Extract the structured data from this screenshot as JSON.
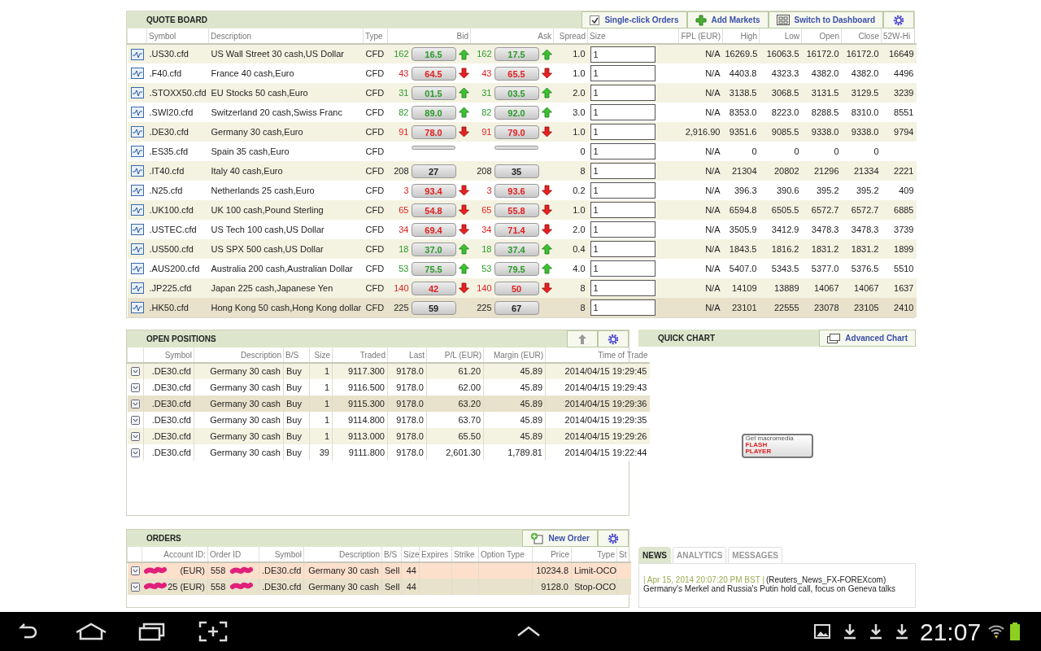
{
  "quote_board": {
    "title": "QUOTE BOARD",
    "toolbar": [
      {
        "kind": "checkbox",
        "label": "Single-click Orders",
        "checked": true
      },
      {
        "kind": "add",
        "label": "Add Markets"
      },
      {
        "kind": "dashboard",
        "label": "Switch to Dashboard"
      },
      {
        "kind": "settings"
      }
    ],
    "columns": [
      "Symbol",
      "Description",
      "Type",
      "Bid",
      "Ask",
      "Spread",
      "Size",
      "FPL (EUR)",
      "High",
      "Low",
      "Open",
      "Close",
      "52W-Hi"
    ],
    "rows": [
      {
        "symbol": ".US30.cfd",
        "description": "US Wall Street 30 cash,US Dollar",
        "type": "CFD",
        "bid": {
          "pips": "162",
          "price": "16.5",
          "kind": "up"
        },
        "ask": {
          "pips": "162",
          "price": "17.5",
          "kind": "up"
        },
        "spread": "1.0",
        "size": "1",
        "fpl": "N/A",
        "high": "16269.5",
        "low": "16063.5",
        "open": "16172.0",
        "close": "16172.0",
        "high_52w": "16649",
        "selected": false
      },
      {
        "symbol": ".F40.cfd",
        "description": "France 40 cash,Euro",
        "type": "CFD",
        "bid": {
          "pips": "43",
          "price": "64.5",
          "kind": "down"
        },
        "ask": {
          "pips": "43",
          "price": "65.5",
          "kind": "down"
        },
        "spread": "1.0",
        "size": "1",
        "fpl": "N/A",
        "high": "4403.8",
        "low": "4323.3",
        "open": "4382.0",
        "close": "4382.0",
        "high_52w": "4496",
        "selected": false
      },
      {
        "symbol": ".STOXX50.cfd",
        "description": "EU Stocks 50 cash,Euro",
        "type": "CFD",
        "bid": {
          "pips": "31",
          "price": "01.5",
          "kind": "up"
        },
        "ask": {
          "pips": "31",
          "price": "03.5",
          "kind": "up"
        },
        "spread": "2.0",
        "size": "1",
        "fpl": "N/A",
        "high": "3138.5",
        "low": "3068.5",
        "open": "3131.5",
        "close": "3129.5",
        "high_52w": "3239",
        "selected": false
      },
      {
        "symbol": ".SWI20.cfd",
        "description": "Switzerland 20 cash,Swiss Franc",
        "type": "CFD",
        "bid": {
          "pips": "82",
          "price": "89.0",
          "kind": "up"
        },
        "ask": {
          "pips": "82",
          "price": "92.0",
          "kind": "up"
        },
        "spread": "3.0",
        "size": "1",
        "fpl": "N/A",
        "high": "8353.0",
        "low": "8223.0",
        "open": "8288.5",
        "close": "8310.0",
        "high_52w": "8551",
        "selected": false
      },
      {
        "symbol": ".DE30.cfd",
        "description": "Germany 30 cash,Euro",
        "type": "CFD",
        "bid": {
          "pips": "91",
          "price": "78.0",
          "kind": "down"
        },
        "ask": {
          "pips": "91",
          "price": "79.0",
          "kind": "down"
        },
        "spread": "1.0",
        "size": "1",
        "fpl": "2,916.90",
        "high": "9351.6",
        "low": "9085.5",
        "open": "9338.0",
        "close": "9338.0",
        "high_52w": "9794",
        "selected": false
      },
      {
        "symbol": ".ES35.cfd",
        "description": "Spain 35 cash,Euro",
        "type": "CFD",
        "bid": {
          "kind": "none"
        },
        "ask": {
          "kind": "none"
        },
        "spread": "0",
        "size": "1",
        "fpl": "N/A",
        "high": "0",
        "low": "0",
        "open": "0",
        "close": "0",
        "selected": false
      },
      {
        "symbol": ".IT40.cfd",
        "description": "Italy 40 cash,Euro",
        "type": "CFD",
        "bid": {
          "pips": "208",
          "price": "27",
          "kind": "none"
        },
        "ask": {
          "pips": "208",
          "price": "35",
          "kind": "none"
        },
        "spread": "8",
        "size": "1",
        "fpl": "N/A",
        "high": "21304",
        "low": "20802",
        "open": "21296",
        "close": "21334",
        "high_52w": "2221",
        "selected": false
      },
      {
        "symbol": ".N25.cfd",
        "description": "Netherlands 25 cash,Euro",
        "type": "CFD",
        "bid": {
          "pips": "3",
          "price": "93.4",
          "kind": "down"
        },
        "ask": {
          "pips": "3",
          "price": "93.6",
          "kind": "down"
        },
        "spread": "0.2",
        "size": "1",
        "fpl": "N/A",
        "high": "396.3",
        "low": "390.6",
        "open": "395.2",
        "close": "395.2",
        "high_52w": "409",
        "selected": false
      },
      {
        "symbol": ".UK100.cfd",
        "description": "UK 100 cash,Pound Sterling",
        "type": "CFD",
        "bid": {
          "pips": "65",
          "price": "54.8",
          "kind": "down"
        },
        "ask": {
          "pips": "65",
          "price": "55.8",
          "kind": "down"
        },
        "spread": "1.0",
        "size": "1",
        "fpl": "N/A",
        "high": "6594.8",
        "low": "6505.5",
        "open": "6572.7",
        "close": "6572.7",
        "high_52w": "6885",
        "selected": false
      },
      {
        "symbol": ".USTEC.cfd",
        "description": "US Tech 100 cash,US Dollar",
        "type": "CFD",
        "bid": {
          "pips": "34",
          "price": "69.4",
          "kind": "down"
        },
        "ask": {
          "pips": "34",
          "price": "71.4",
          "kind": "down"
        },
        "spread": "2.0",
        "size": "1",
        "fpl": "N/A",
        "high": "3505.9",
        "low": "3412.9",
        "open": "3478.3",
        "close": "3478.3",
        "high_52w": "3739",
        "selected": false
      },
      {
        "symbol": ".US500.cfd",
        "description": "US SPX 500 cash,US Dollar",
        "type": "CFD",
        "bid": {
          "pips": "18",
          "price": "37.0",
          "kind": "up"
        },
        "ask": {
          "pips": "18",
          "price": "37.4",
          "kind": "up"
        },
        "spread": "0.4",
        "size": "1",
        "fpl": "N/A",
        "high": "1843.5",
        "low": "1816.2",
        "open": "1831.2",
        "close": "1831.2",
        "high_52w": "1899",
        "selected": false
      },
      {
        "symbol": ".AUS200.cfd",
        "description": "Australia 200 cash,Australian Dollar",
        "type": "CFD",
        "bid": {
          "pips": "53",
          "price": "75.5",
          "kind": "up"
        },
        "ask": {
          "pips": "53",
          "price": "79.5",
          "kind": "up"
        },
        "spread": "4.0",
        "size": "1",
        "fpl": "N/A",
        "high": "5407.0",
        "low": "5343.5",
        "open": "5377.0",
        "close": "5376.5",
        "high_52w": "5510",
        "selected": false
      },
      {
        "symbol": ".JP225.cfd",
        "description": "Japan 225 cash,Japanese Yen",
        "type": "CFD",
        "bid": {
          "pips": "140",
          "price": "42",
          "kind": "down"
        },
        "ask": {
          "pips": "140",
          "price": "50",
          "kind": "down"
        },
        "spread": "8",
        "size": "1",
        "fpl": "N/A",
        "high": "14109",
        "low": "13889",
        "open": "14067",
        "close": "14067",
        "high_52w": "1637",
        "selected": false
      },
      {
        "symbol": ".HK50.cfd",
        "description": "Hong Kong 50 cash,Hong Kong dollar",
        "type": "CFD",
        "bid": {
          "pips": "225",
          "price": "59",
          "kind": "none"
        },
        "ask": {
          "pips": "225",
          "price": "67",
          "kind": "none"
        },
        "spread": "8",
        "size": "1",
        "fpl": "N/A",
        "high": "23101",
        "low": "22555",
        "open": "23078",
        "close": "23105",
        "high_52w": "2410",
        "selected": true
      }
    ]
  },
  "open_positions": {
    "title": "OPEN POSITIONS",
    "toolbar": [
      {
        "kind": "up"
      },
      {
        "kind": "settings"
      }
    ],
    "columns": [
      "Symbol",
      "Description",
      "B/S",
      "Size",
      "Traded",
      "Last",
      "P/L (EUR)",
      "Margin (EUR)",
      "Time of Trade"
    ],
    "rows": [
      {
        "cells": [
          ".DE30.cfd",
          "Germany 30 cash",
          "Buy",
          "1",
          "9117.300",
          "9178.0",
          "61.20",
          "45.89",
          "2014/04/15 19:29:45"
        ],
        "selected": false
      },
      {
        "cells": [
          ".DE30.cfd",
          "Germany 30 cash",
          "Buy",
          "1",
          "9116.500",
          "9178.0",
          "62.00",
          "45.89",
          "2014/04/15 19:29:43"
        ],
        "selected": false
      },
      {
        "cells": [
          ".DE30.cfd",
          "Germany 30 cash",
          "Buy",
          "1",
          "9115.300",
          "9178.0",
          "63.20",
          "45.89",
          "2014/04/15 19:29:36"
        ],
        "selected": true
      },
      {
        "cells": [
          ".DE30.cfd",
          "Germany 30 cash",
          "Buy",
          "1",
          "9114.800",
          "9178.0",
          "63.70",
          "45.89",
          "2014/04/15 19:29:35"
        ],
        "selected": false
      },
      {
        "cells": [
          ".DE30.cfd",
          "Germany 30 cash",
          "Buy",
          "1",
          "9113.000",
          "9178.0",
          "65.50",
          "45.89",
          "2014/04/15 19:29:26"
        ],
        "selected": false
      },
      {
        "cells": [
          ".DE30.cfd",
          "Germany 30 cash",
          "Buy",
          "39",
          "9111.800",
          "9178.0",
          "2,601.30",
          "1,789.81",
          "2014/04/15 19:22:44"
        ],
        "selected": false
      }
    ]
  },
  "orders": {
    "title": "ORDERS",
    "toolbar": [
      {
        "kind": "new",
        "label": "New Order"
      },
      {
        "kind": "settings"
      }
    ],
    "columns": [
      "Account ID:",
      "Order ID",
      "Symbol",
      "Description",
      "B/S",
      "Size",
      "Expires",
      "Strike",
      "Option Type",
      "Price",
      "Type",
      "St"
    ],
    "rows": [
      {
        "cells": [
          "(EUR)",
          "558",
          ".DE30.cfd",
          "Germany 30 cash",
          "Sell",
          "44",
          "",
          "",
          "",
          "10234.8",
          "Limit-OCO",
          ""
        ],
        "selected": false
      },
      {
        "cells": [
          "25 (EUR)",
          "558",
          ".DE30.cfd",
          "Germany 30 cash",
          "Sell",
          "44",
          "",
          "",
          "",
          "9128.0",
          "Stop-OCO",
          ""
        ],
        "selected": true
      }
    ]
  },
  "quick_chart": {
    "title": "QUICK CHART",
    "button": "Advanced Chart",
    "plugin_badge": {
      "line_1": "Get macromedia",
      "line_2": "FLASH",
      "line_3": "PLAYER"
    }
  },
  "news": {
    "tabs": [
      {
        "label": "NEWS",
        "selected": true
      },
      {
        "label": "ANALYTICS",
        "selected": false
      },
      {
        "label": "MESSAGES",
        "selected": false
      }
    ],
    "items": [
      {
        "date": "| Apr 15, 2014 20:07:20 PM BST |",
        "source": "(Reuters_News_FX-FOREXcom)",
        "headline": "Germany's Merkel and Russia's Putin hold call, focus on Geneva talks"
      }
    ]
  },
  "system_bar": {
    "time": "21:07"
  }
}
